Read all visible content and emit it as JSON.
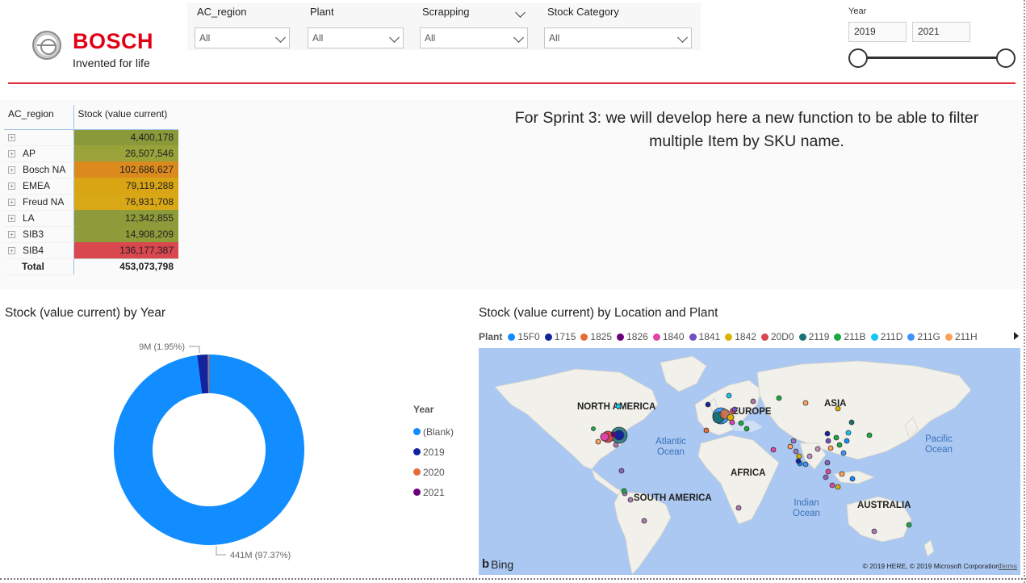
{
  "brand": {
    "name": "BOSCH",
    "tagline": "Invented for life"
  },
  "slicers": [
    {
      "title": "AC_region",
      "value": "All"
    },
    {
      "title": "Plant",
      "value": "All"
    },
    {
      "title": "Scrapping",
      "value": "All"
    },
    {
      "title": "Stock Category",
      "value": "All"
    }
  ],
  "year_slicer": {
    "title": "Year",
    "from": "2019",
    "to": "2021",
    "range_position": {
      "from_fraction": 0.0,
      "to_fraction": 1.0
    }
  },
  "matrix": {
    "headers": [
      "AC_region",
      "Stock (value current)"
    ],
    "rows": [
      {
        "region": "",
        "value": "4,400,178",
        "color": "#8a9a3b"
      },
      {
        "region": "AP",
        "value": "26,507,546",
        "color": "#9aa23a"
      },
      {
        "region": "Bosch NA",
        "value": "102,686,627",
        "color": "#dc8a1e"
      },
      {
        "region": "EMEA",
        "value": "79,119,288",
        "color": "#d9a514"
      },
      {
        "region": "Freud NA",
        "value": "76,931,708",
        "color": "#d9a816"
      },
      {
        "region": "LA",
        "value": "12,342,855",
        "color": "#8d9b3a"
      },
      {
        "region": "SIB3",
        "value": "14,908,209",
        "color": "#8f9c3a"
      },
      {
        "region": "SIB4",
        "value": "136,177,387",
        "color": "#d9474f"
      }
    ],
    "total_label": "Total",
    "total_value": "453,073,798"
  },
  "sprint_note": {
    "line1": "For Sprint 3: we will develop here a new function to be able to filter",
    "line2": "multiple Item by SKU name."
  },
  "donut": {
    "title": "Stock (value current) by Year",
    "legend_title": "Year"
  },
  "chart_data": {
    "type": "pie",
    "title": "Stock (value current) by Year",
    "categories": [
      "(Blank)",
      "2019",
      "2020",
      "2021"
    ],
    "values": [
      441,
      8.0,
      1.0,
      0.0
    ],
    "colors": [
      "#118dff",
      "#12239e",
      "#e66c37",
      "#6b007b"
    ],
    "data_labels": [
      {
        "text": "441M (97.37%)"
      },
      {
        "text": "9M (1.95%)"
      }
    ],
    "legend_placement": "right"
  },
  "map": {
    "title": "Stock (value current) by Location and Plant",
    "legend_title": "Plant",
    "plants": [
      {
        "name": "15F0",
        "color": "#118dff"
      },
      {
        "name": "1715",
        "color": "#12239e"
      },
      {
        "name": "1825",
        "color": "#e66c37"
      },
      {
        "name": "1826",
        "color": "#6b007b"
      },
      {
        "name": "1840",
        "color": "#e044a7"
      },
      {
        "name": "1841",
        "color": "#744ec2"
      },
      {
        "name": "1842",
        "color": "#d9b300"
      },
      {
        "name": "20D0",
        "color": "#d64550"
      },
      {
        "name": "2119",
        "color": "#197278"
      },
      {
        "name": "211B",
        "color": "#1aab40"
      },
      {
        "name": "211D",
        "color": "#15c6f4"
      },
      {
        "name": "211G",
        "color": "#4092ff"
      },
      {
        "name": "211H",
        "color": "#ffa058"
      }
    ],
    "labels": {
      "north_america": "NORTH AMERICA",
      "europe": "EUROPE",
      "asia": "ASIA",
      "africa": "AFRICA",
      "south_america": "SOUTH AMERICA",
      "australia": "AUSTRALIA",
      "atlantic": "Atlantic Ocean",
      "pacific": "Pacific Ocean",
      "indian": "Indian Ocean"
    },
    "bing": "Bing",
    "copyright": "© 2019 HERE, © 2019 Microsoft Corporation",
    "terms": "Terms"
  }
}
